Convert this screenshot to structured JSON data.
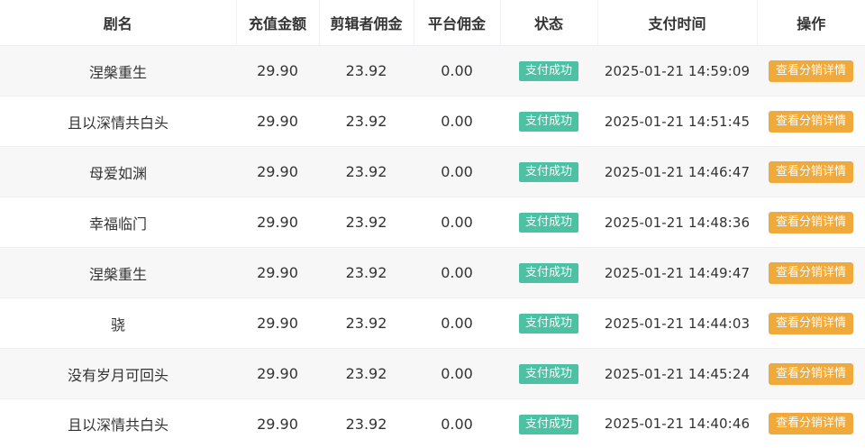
{
  "table": {
    "headers": {
      "name": "剧名",
      "amount": "充值金额",
      "editor_commission": "剪辑者佣金",
      "platform_commission": "平台佣金",
      "status": "状态",
      "pay_time": "支付时间",
      "actions": "操作"
    },
    "rows": [
      {
        "name": "涅槃重生",
        "amount": "29.90",
        "editor_commission": "23.92",
        "platform_commission": "0.00",
        "status": "支付成功",
        "pay_time": "2025-01-21 14:59:09",
        "action_label": "查看分销详情"
      },
      {
        "name": "且以深情共白头",
        "amount": "29.90",
        "editor_commission": "23.92",
        "platform_commission": "0.00",
        "status": "支付成功",
        "pay_time": "2025-01-21 14:51:45",
        "action_label": "查看分销详情"
      },
      {
        "name": "母爱如渊",
        "amount": "29.90",
        "editor_commission": "23.92",
        "platform_commission": "0.00",
        "status": "支付成功",
        "pay_time": "2025-01-21 14:46:47",
        "action_label": "查看分销详情"
      },
      {
        "name": "幸福临门",
        "amount": "29.90",
        "editor_commission": "23.92",
        "platform_commission": "0.00",
        "status": "支付成功",
        "pay_time": "2025-01-21 14:48:36",
        "action_label": "查看分销详情"
      },
      {
        "name": "涅槃重生",
        "amount": "29.90",
        "editor_commission": "23.92",
        "platform_commission": "0.00",
        "status": "支付成功",
        "pay_time": "2025-01-21 14:49:47",
        "action_label": "查看分销详情"
      },
      {
        "name": "骁",
        "amount": "29.90",
        "editor_commission": "23.92",
        "platform_commission": "0.00",
        "status": "支付成功",
        "pay_time": "2025-01-21 14:44:03",
        "action_label": "查看分销详情"
      },
      {
        "name": "没有岁月可回头",
        "amount": "29.90",
        "editor_commission": "23.92",
        "platform_commission": "0.00",
        "status": "支付成功",
        "pay_time": "2025-01-21 14:45:24",
        "action_label": "查看分销详情"
      },
      {
        "name": "且以深情共白头",
        "amount": "29.90",
        "editor_commission": "23.92",
        "platform_commission": "0.00",
        "status": "支付成功",
        "pay_time": "2025-01-21 14:40:46",
        "action_label": "查看分销详情"
      }
    ]
  },
  "colors": {
    "status_success": "#4cc1a3",
    "action_button": "#f0a93b",
    "row_stripe": "#f7f7f7"
  }
}
